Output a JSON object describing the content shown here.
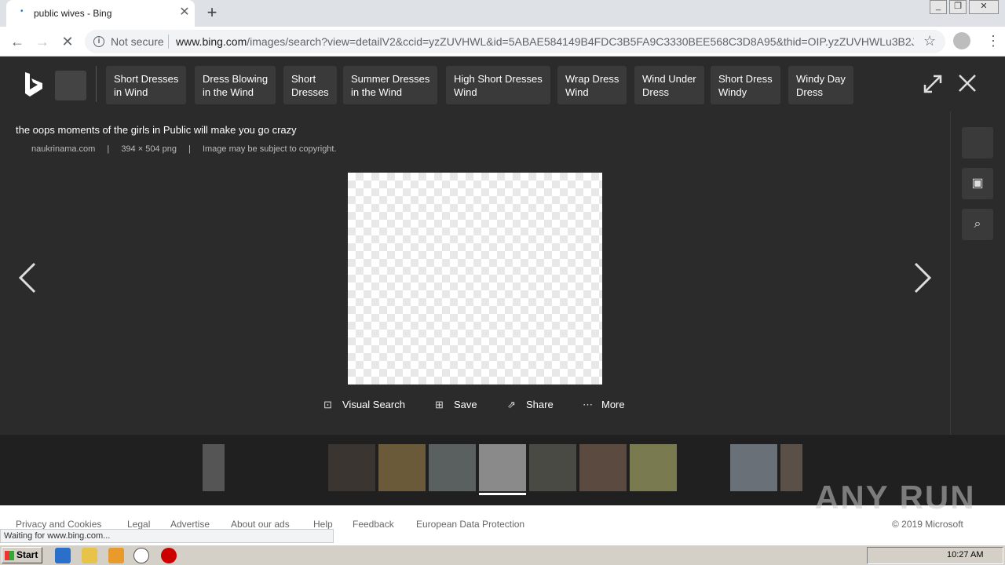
{
  "browser": {
    "tab_title": "public wives - Bing",
    "tab_close": "✕",
    "new_tab": "+",
    "not_secure": "Not secure",
    "url_domain": "www.bing.com",
    "url_rest": "/images/search?view=detailV2&ccid=yzZUVHWL&id=5ABAE584149B4FDC3B5FA9C3330BEE568C3D8A95&thid=OIP.yzZUVHWLu3B2J_...",
    "status_text": "Waiting for www.bing.com..."
  },
  "bing": {
    "related_searches": [
      {
        "label": "Short Dresses\nin Wind"
      },
      {
        "label": "Dress Blowing\nin the Wind"
      },
      {
        "label": "Short\nDresses"
      },
      {
        "label": "Summer Dresses\nin the Wind"
      },
      {
        "label": "High Short Dresses\nWind"
      },
      {
        "label": "Wrap Dress\nWind"
      },
      {
        "label": "Wind Under\nDress"
      },
      {
        "label": "Short Dress\nWindy"
      },
      {
        "label": "Windy Day\nDress"
      }
    ]
  },
  "detail": {
    "title": "the oops moments of the girls in Public will make you go crazy",
    "source": "naukrinama.com",
    "dimensions": "394 × 504 png",
    "copyright_note": "Image may be subject to copyright.",
    "separator": "|",
    "actions": {
      "visual_search": "Visual Search",
      "save": "Save",
      "share": "Share",
      "more": "More"
    }
  },
  "thumbnails": [
    {
      "color": "#555"
    },
    {
      "color": "#3a3530"
    },
    {
      "color": "#6a5a3a"
    },
    {
      "color": "#5a6060"
    },
    {
      "color": "#8a8a8a"
    },
    {
      "color": "#4a4a44"
    },
    {
      "color": "#5a4a40"
    },
    {
      "color": "#7a7a50"
    },
    {
      "color": "#6a7078"
    },
    {
      "color": "#5a5048"
    }
  ],
  "footer": {
    "links": [
      "Privacy and Cookies",
      "Legal",
      "Advertise",
      "About our ads",
      "Help",
      "Feedback",
      "European Data Protection"
    ],
    "copyright": "© 2019 Microsoft"
  },
  "watermark": "ANY RUN",
  "taskbar": {
    "start": "Start",
    "clock": "10:27 AM"
  }
}
